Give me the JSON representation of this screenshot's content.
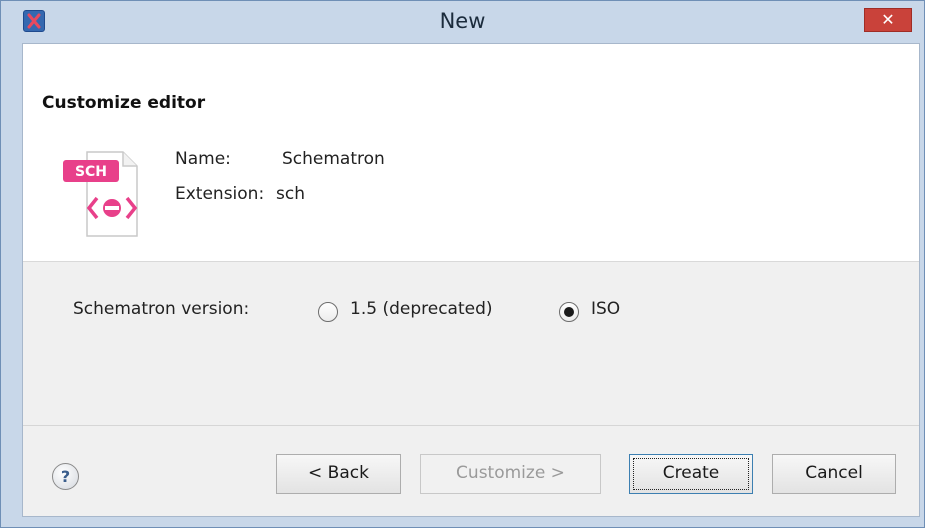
{
  "window": {
    "title": "New",
    "close_glyph": "✕"
  },
  "header": {
    "title": "Customize editor",
    "icon_badge": "SCH",
    "name_label": "Name:",
    "name_value": "Schematron",
    "extension_label": "Extension:",
    "extension_value": "sch"
  },
  "options": {
    "version_label": "Schematron version:",
    "radios": [
      {
        "label": "1.5 (deprecated)",
        "selected": false
      },
      {
        "label": "ISO",
        "selected": true
      }
    ]
  },
  "footer": {
    "help_glyph": "?",
    "back_label": "< Back",
    "customize_label": "Customize >",
    "create_label": "Create",
    "cancel_label": "Cancel"
  },
  "colors": {
    "accent_pink": "#e8408a",
    "close_red": "#c9423a",
    "title_bar": "#c8d7e9"
  }
}
